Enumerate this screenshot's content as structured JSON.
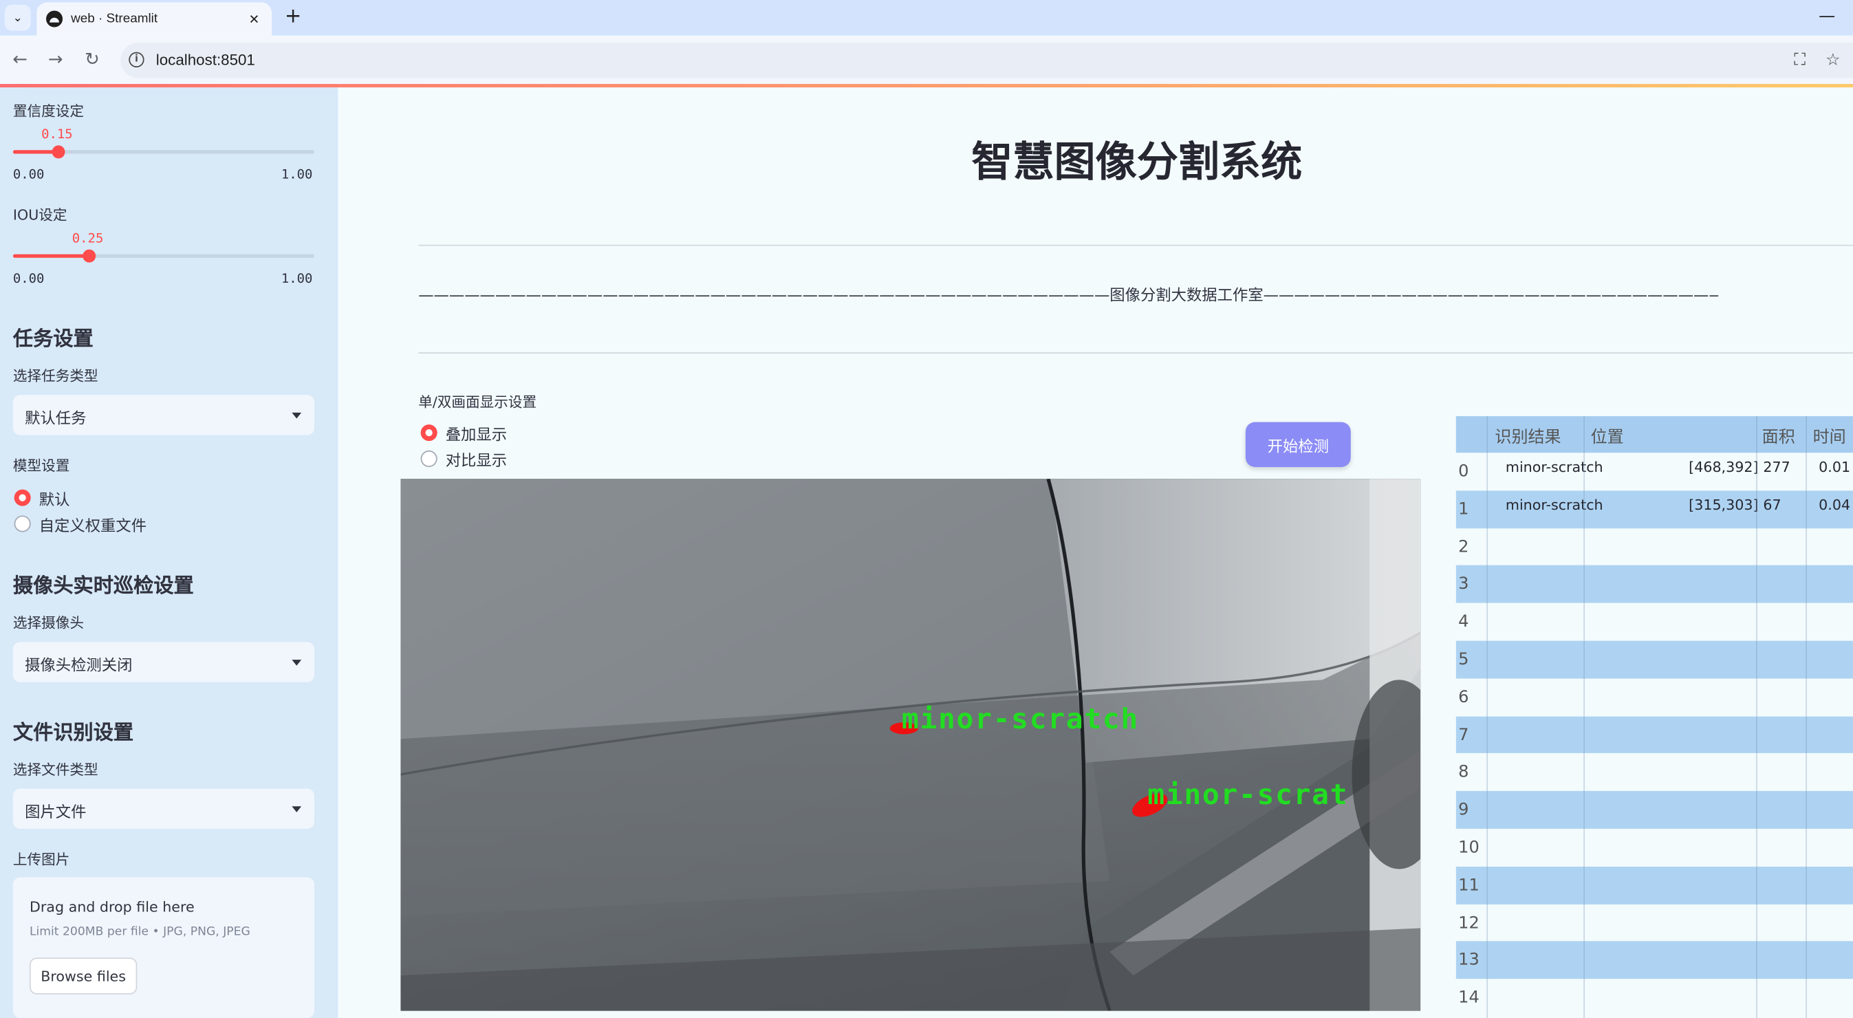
{
  "browser": {
    "tab_title": "web · Streamlit",
    "url": "localhost:8501",
    "new_tab": "+",
    "close": "✕",
    "minimize": "—",
    "back": "←",
    "forward": "→",
    "reload": "↻",
    "info_glyph": "i",
    "translate_glyph": "⛶",
    "star": "☆",
    "tab_dropdown": "⌄"
  },
  "sidebar": {
    "confidence": {
      "label": "置信度设定",
      "value": "0.15",
      "value_num": 0.15,
      "min": "0.00",
      "max": "1.00"
    },
    "iou": {
      "label": "IOU设定",
      "value": "0.25",
      "value_num": 0.25,
      "min": "0.00",
      "max": "1.00"
    },
    "task_heading": "任务设置",
    "task_type_label": "选择任务类型",
    "task_type_value": "默认任务",
    "model_label": "模型设置",
    "model_options": [
      "默认",
      "自定义权重文件"
    ],
    "model_selected": "默认",
    "camera_heading": "摄像头实时巡检设置",
    "camera_label": "选择摄像头",
    "camera_value": "摄像头检测关闭",
    "file_heading": "文件识别设置",
    "file_type_label": "选择文件类型",
    "file_type_value": "图片文件",
    "upload_label": "上传图片",
    "upload_title": "Drag and drop file here",
    "upload_limit": "Limit 200MB per file • JPG, PNG, JPEG",
    "upload_button": "Browse files"
  },
  "main": {
    "title": "智慧图像分割系统",
    "subtitle_line": "—————————————————————————————————————————————图像分割大数据工作室—————————————————————————————————————————————",
    "display_mode_label": "单/双画面显示设置",
    "display_options": [
      "叠加显示",
      "对比显示"
    ],
    "display_selected": "叠加显示",
    "start_button": "开始检测",
    "detections_overlay": [
      "minor-scratch",
      "minor-scrat"
    ]
  },
  "table": {
    "columns": [
      "识别结果",
      "位置",
      "面积",
      "时间"
    ],
    "rows": [
      {
        "index": "0",
        "result": "minor-scratch",
        "position": "[468,392]",
        "area": "277",
        "time": "0.01"
      },
      {
        "index": "1",
        "result": "minor-scratch",
        "position": "[315,303]",
        "area": "67",
        "time": "0.04"
      },
      {
        "index": "2",
        "result": "",
        "position": "",
        "area": "",
        "time": ""
      },
      {
        "index": "3",
        "result": "",
        "position": "",
        "area": "",
        "time": ""
      },
      {
        "index": "4",
        "result": "",
        "position": "",
        "area": "",
        "time": ""
      },
      {
        "index": "5",
        "result": "",
        "position": "",
        "area": "",
        "time": ""
      },
      {
        "index": "6",
        "result": "",
        "position": "",
        "area": "",
        "time": ""
      },
      {
        "index": "7",
        "result": "",
        "position": "",
        "area": "",
        "time": ""
      },
      {
        "index": "8",
        "result": "",
        "position": "",
        "area": "",
        "time": ""
      },
      {
        "index": "9",
        "result": "",
        "position": "",
        "area": "",
        "time": ""
      },
      {
        "index": "10",
        "result": "",
        "position": "",
        "area": "",
        "time": ""
      },
      {
        "index": "11",
        "result": "",
        "position": "",
        "area": "",
        "time": ""
      },
      {
        "index": "12",
        "result": "",
        "position": "",
        "area": "",
        "time": ""
      },
      {
        "index": "13",
        "result": "",
        "position": "",
        "area": "",
        "time": ""
      },
      {
        "index": "14",
        "result": "",
        "position": "",
        "area": "",
        "time": ""
      }
    ]
  },
  "colors": {
    "accent": "#ff4b4b",
    "button": "#8b8cf5",
    "sidebar_bg": "#d8e9f8",
    "table_stripe": "#aed3f2",
    "detection_mask": "#ee1111",
    "detection_text": "#22dd22"
  }
}
